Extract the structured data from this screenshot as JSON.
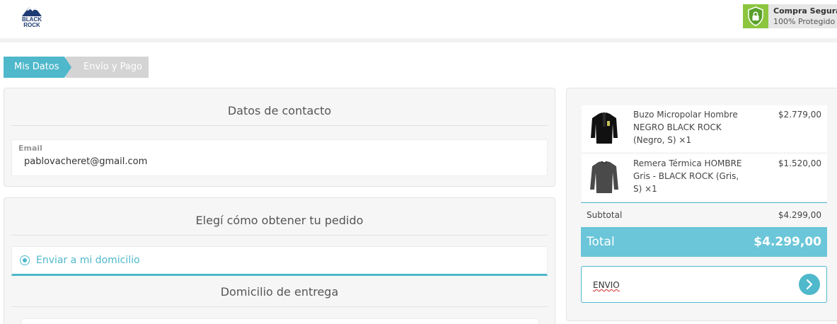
{
  "header": {
    "logo_line1": "BLACK",
    "logo_line2": "ROCK",
    "secure_title": "Compra Segura",
    "secure_subtitle": "100% Protegido",
    "shield_icon": "shield-lock-icon"
  },
  "steps": [
    {
      "label": "Mis Datos",
      "active": true
    },
    {
      "label": "Envío y Pago",
      "active": false
    }
  ],
  "contact": {
    "title": "Datos de contacto",
    "email_label": "Email",
    "email_value": "pablovacheret@gmail.com"
  },
  "shipping": {
    "title": "Elegí cómo obtener tu pedido",
    "option_label": "Enviar a mi domicilio",
    "option_selected": true,
    "address_title": "Domicilio de entrega"
  },
  "summary": {
    "items": [
      {
        "name": "Buzo Micropolar Hombre NEGRO BLACK ROCK (Negro, S) ×1",
        "price": "$2.779,00"
      },
      {
        "name": "Remera Térmica HOMBRE Gris - BLACK ROCK (Gris, S) ×1",
        "price": "$1.520,00"
      }
    ],
    "subtotal_label": "Subtotal",
    "subtotal_value": "$4.299,00",
    "total_label": "Total",
    "total_value": "$4.299,00",
    "coupon_value": "ENVIO",
    "coupon_icon": "chevron-right-icon"
  },
  "colors": {
    "accent": "#4fb8cb",
    "total_bar": "#6ac6d8",
    "secure_green": "#8cc63f"
  }
}
